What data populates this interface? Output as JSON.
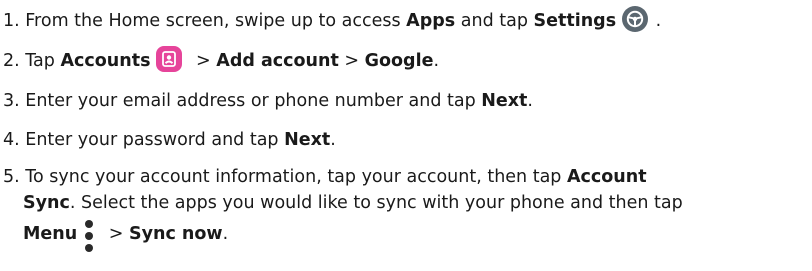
{
  "steps": [
    {
      "number": "1.",
      "t1": " From the Home screen, swipe up to access ",
      "b1": "Apps",
      "t2": " and tap ",
      "b2": "Settings",
      "icon": "settings-icon",
      "t3": " ."
    },
    {
      "number": "2.",
      "t1": " Tap ",
      "b1": "Accounts",
      "icon": "accounts-icon",
      "t2": " > ",
      "b2": "Add account",
      "t3": " > ",
      "b3": "Google",
      "t4": "."
    },
    {
      "number": "3.",
      "t1": " Enter your email address or phone number and tap ",
      "b1": "Next",
      "t2": "."
    },
    {
      "number": "4.",
      "t1": " Enter your password and tap ",
      "b1": "Next",
      "t2": "."
    },
    {
      "number": "5.",
      "t1": " To sync your account information, tap your account, then tap ",
      "b1": "Account",
      "b2": "Sync",
      "t2": ". Select the apps you would like to sync with your phone and then tap",
      "b3": "Menu",
      "icon": "menu-icon",
      "t3": " > ",
      "b4": "Sync now",
      "t4": "."
    }
  ],
  "colors": {
    "text": "#1a1a1a",
    "settings_icon_bg": "#5b6770",
    "accounts_icon_bg": "#e6449a"
  }
}
